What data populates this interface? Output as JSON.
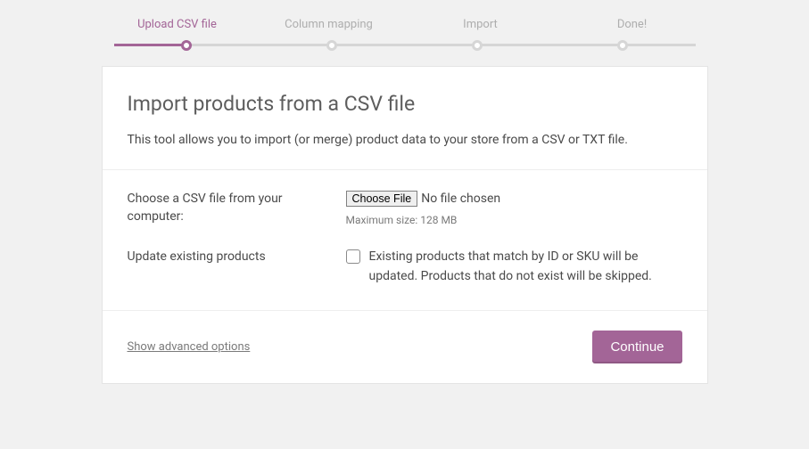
{
  "stepper": {
    "steps": [
      "Upload CSV file",
      "Column mapping",
      "Import",
      "Done!"
    ],
    "active_index": 0
  },
  "header": {
    "title": "Import products from a CSV file",
    "subtitle": "This tool allows you to import (or merge) product data to your store from a CSV or TXT file."
  },
  "file_field": {
    "label": "Choose a CSV file from your computer:",
    "button": "Choose File",
    "status": "No file chosen",
    "hint": "Maximum size: 128 MB"
  },
  "update_field": {
    "label": "Update existing products",
    "description": "Existing products that match by ID or SKU will be updated. Products that do not exist will be skipped.",
    "checked": false
  },
  "footer": {
    "advanced": "Show advanced options",
    "continue": "Continue"
  }
}
